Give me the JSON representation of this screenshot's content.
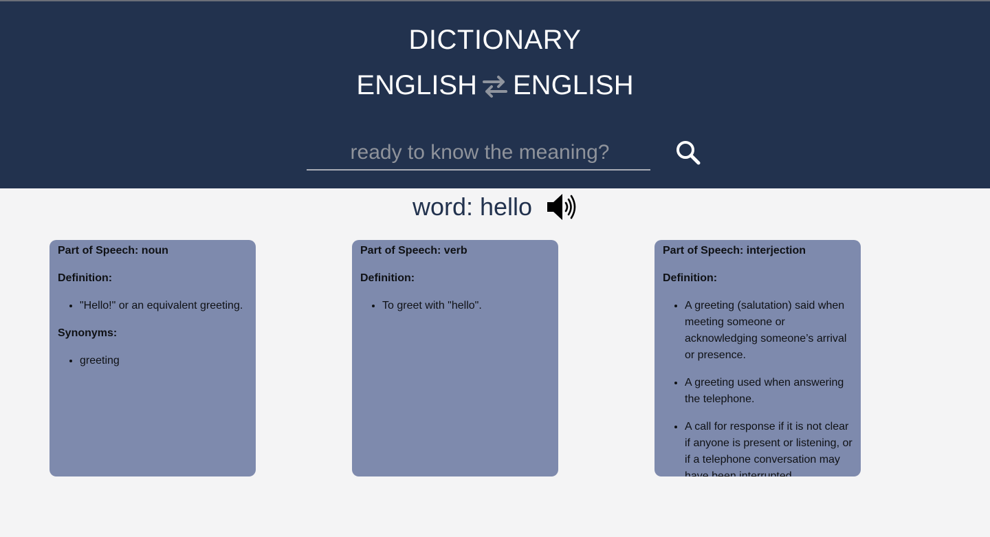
{
  "header": {
    "title": "DICTIONARY",
    "lang_from": "ENGLISH",
    "lang_to": "ENGLISH",
    "swap_icon": "swap-arrows-icon"
  },
  "search": {
    "placeholder": "ready to know the meaning?",
    "value": "",
    "button_icon": "search-icon"
  },
  "result": {
    "word_text": "word: hello",
    "audio_icon": "speaker-icon"
  },
  "cards": [
    {
      "part_of_speech": "Part of Speech: noun",
      "definition_label": "Definition:",
      "definitions": [
        "\"Hello!\" or an equivalent greeting."
      ],
      "synonyms_label": "Synonyms:",
      "synonyms": [
        "greeting"
      ]
    },
    {
      "part_of_speech": "Part of Speech: verb",
      "definition_label": "Definition:",
      "definitions": [
        "To greet with \"hello\"."
      ]
    },
    {
      "part_of_speech": "Part of Speech: interjection",
      "definition_label": "Definition:",
      "definitions": [
        "A greeting (salutation) said when meeting someone or acknowledging someone’s arrival or presence.",
        "A greeting used when answering the telephone.",
        "A call for response if it is not clear if anyone is present or listening, or if a telephone conversation may have been interrupted."
      ]
    }
  ],
  "colors": {
    "header_bg": "#22324e",
    "card_bg": "#7e8aad",
    "page_bg": "#f4f4f5"
  }
}
